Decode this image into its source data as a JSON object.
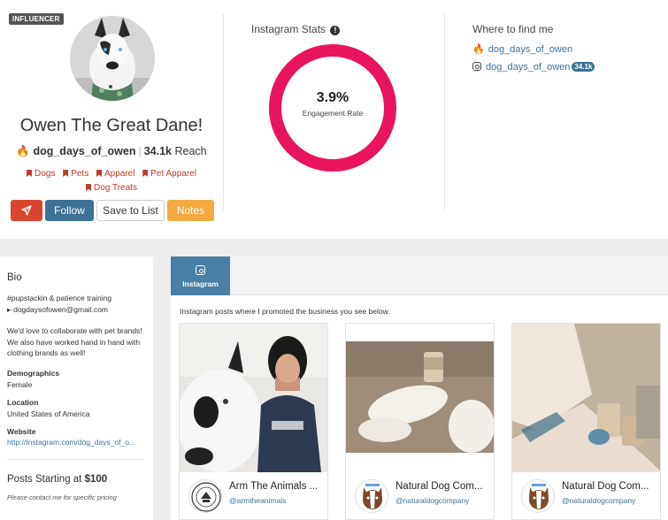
{
  "profile": {
    "badge": "INFLUENCER",
    "name": "Owen The Great Dane!",
    "handle": "dog_days_of_owen",
    "reach_value": "34.1k",
    "reach_label": "Reach",
    "tags": [
      "Dogs",
      "Pets",
      "Apparel",
      "Pet Apparel",
      "Dog Treats"
    ]
  },
  "actions": {
    "follow": "Follow",
    "save": "Save to List",
    "notes": "Notes"
  },
  "stats": {
    "title": "Instagram Stats",
    "engagement_value": "3.9%",
    "engagement_label": "Engagement Rate",
    "ring_color": "#e8145e"
  },
  "where": {
    "title": "Where to find me",
    "items": [
      {
        "icon": "fire-icon",
        "label": "dog_days_of_owen"
      },
      {
        "icon": "instagram-icon",
        "label": "dog_days_of_owen",
        "badge": "34.1k"
      }
    ]
  },
  "sidebar": {
    "bio_title": "Bio",
    "bio_line1": "#pupstackin & patience training",
    "bio_line2": "▸·dogdaysofowen@gmail.com",
    "bio_paragraph": "We'd love to collaborate with pet brands! We also have worked hand in hand with clothing brands as well!",
    "demographics_label": "Demographics",
    "demographics_value": "Female",
    "location_label": "Location",
    "location_value": "United States of America",
    "website_label": "Website",
    "website_value": "http://Instagram.com/dog_days_of_o...",
    "price_prefix": "Posts Starting at",
    "price": "$100",
    "price_note": "Please contact me for specific pricing"
  },
  "main": {
    "tab_label": "Instagram",
    "intro": "Instagram posts where I promoted the business you see below.",
    "cards": [
      {
        "name": "Arm The Animals ...",
        "handle": "@armtheanimals"
      },
      {
        "name": "Natural Dog Com...",
        "handle": "@naturaldogcompany"
      },
      {
        "name": "Natural Dog Com...",
        "handle": "@naturaldogcompany"
      }
    ]
  },
  "colors": {
    "primary": "#3d7196",
    "danger": "#d9452f",
    "warning": "#f4a940",
    "tag": "#c0392b"
  }
}
